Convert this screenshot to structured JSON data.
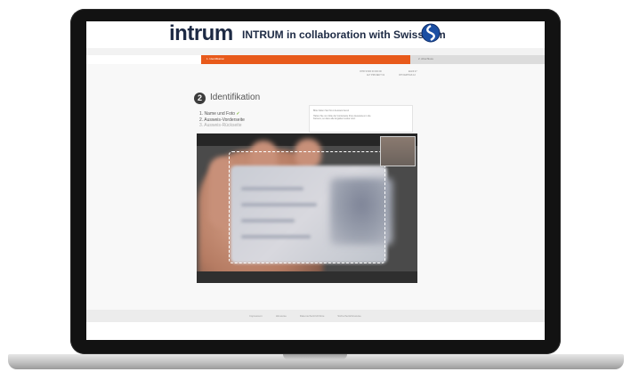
{
  "banner": {
    "logo": "intrum",
    "title": "INTRUM in collaboration with Swisscom"
  },
  "progress": {
    "step1_label": "1. Identifikation",
    "step2_label": "2. Abschluss",
    "fraction": 0.61
  },
  "header_meta": {
    "left_line1": "INTR STAR 00 000 00",
    "left_line2": "ALT PROJECT 01",
    "right_line1": "EGNI 07",
    "right_line2": "IDT FERTIGS 12"
  },
  "main": {
    "step_number": "2",
    "title": "Identifikation",
    "checklist": [
      {
        "label": "1. Name und Foto",
        "state": "done"
      },
      {
        "label": "2. Ausweis-Vorderseite",
        "state": "done"
      },
      {
        "label": "3. Ausweis-Rückseite",
        "state": "todo"
      }
    ],
    "info_lines": [
      "Bitte halten Sie Ihren Ausweis bereit",
      "Halten Sie nun bitte die Vorderseite Ihres Ausweises in die",
      "Kamera, so dass alle Angaben lesbar sind."
    ]
  },
  "footer": {
    "links": [
      "Impressum",
      "Hinweise",
      "Datenschutzrichtlinie",
      "Sicherheitshinweise"
    ]
  },
  "colors": {
    "accent": "#e85a1b",
    "brand_navy": "#1d2a44",
    "check_green": "#7db83a"
  }
}
